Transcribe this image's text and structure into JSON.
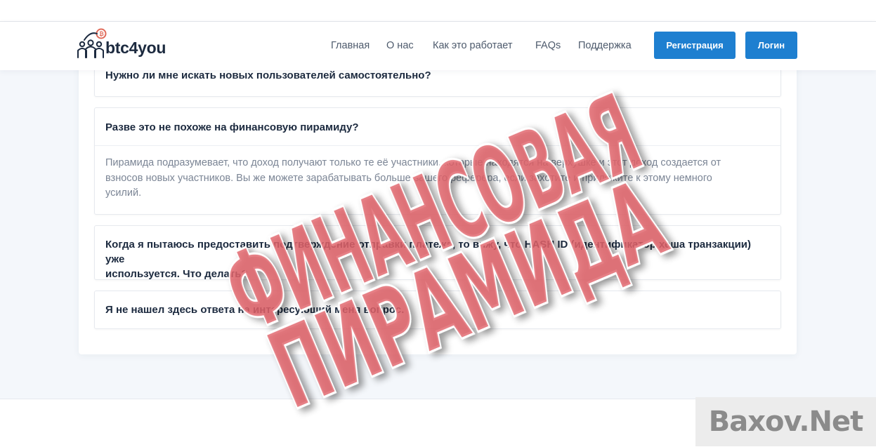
{
  "brand": {
    "name": "btc4you",
    "logo_icon": "people-bitcoin-logo-icon"
  },
  "nav": {
    "links": [
      "Главная",
      "О нас",
      "Как это работает",
      "FAQs",
      "Поддержка"
    ],
    "register_label": "Регистрация",
    "login_label": "Логин",
    "accent_color": "#1e7fd0"
  },
  "faq": [
    {
      "question": "Нужно ли мне искать новых пользователей самостоятельно?"
    },
    {
      "question": "Разве это не похоже на финансовую пирамиду?",
      "answer_lines": [
        "Пирамида подразумевает, что доход получают только те её участники, которые находятся на верхушке и этот доход создается от",
        "взносов новых участников. Вы же можете зарабатывать больше вашего реферера, если захотите и приложите к этому немного",
        "усилий."
      ]
    },
    {
      "question_lines": [
        "Когда я пытаюсь предоставить подтверждение отправки платежа, то вижу, что HASH ID (идентификатор хеша транзакции) уже",
        "используется. Что делать?"
      ]
    },
    {
      "question": "Я не нашел здесь ответа на интересующий меня вопрос."
    }
  ],
  "stamp": {
    "line1": "ФИНАНСОВАЯ",
    "line2": "ПИРАМИДА",
    "color": "#e0636a"
  },
  "watermark": {
    "text": "Baxov.Net"
  }
}
